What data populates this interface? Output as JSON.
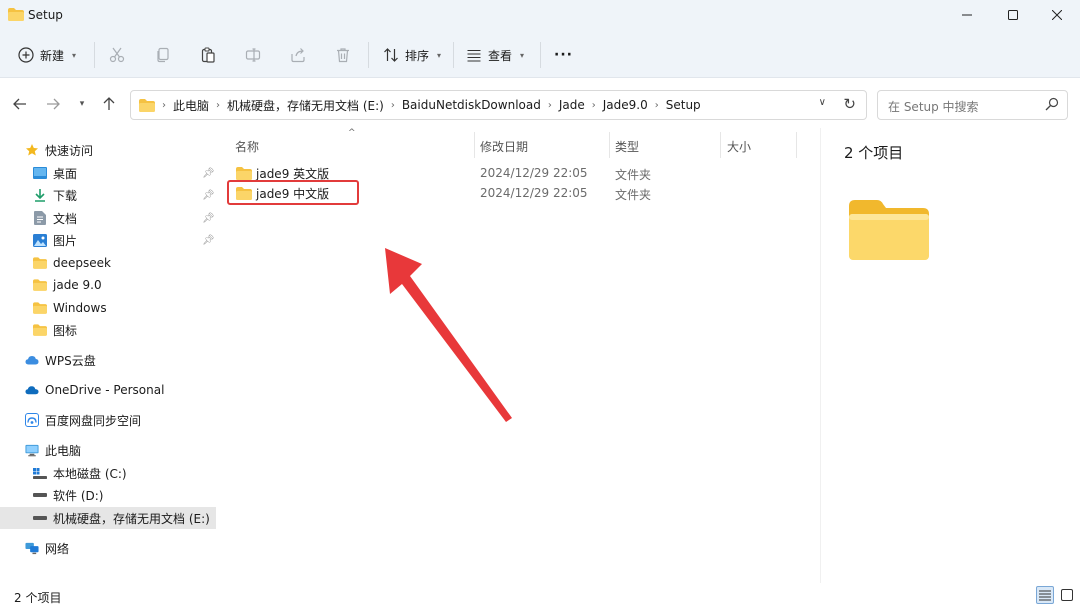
{
  "window": {
    "title": "Setup"
  },
  "toolbar": {
    "new_label": "新建",
    "sort_label": "排序",
    "view_label": "查看",
    "more_label": "···"
  },
  "address": {
    "crumbs": [
      "此电脑",
      "机械硬盘，存储无用文档 (E:)",
      "BaiduNetdiskDownload",
      "Jade",
      "Jade9.0",
      "Setup"
    ]
  },
  "search": {
    "placeholder": "在 Setup 中搜索"
  },
  "sidebar": {
    "quick_access": "快速访问",
    "items": [
      {
        "label": "桌面",
        "icon": "desktop-icon"
      },
      {
        "label": "下载",
        "icon": "download-icon"
      },
      {
        "label": "文档",
        "icon": "document-icon"
      },
      {
        "label": "图片",
        "icon": "picture-icon"
      },
      {
        "label": "deepseek",
        "icon": "folder-icon"
      },
      {
        "label": "jade 9.0",
        "icon": "folder-icon"
      },
      {
        "label": "Windows",
        "icon": "folder-icon"
      },
      {
        "label": "图标",
        "icon": "folder-icon"
      }
    ],
    "wps": "WPS云盘",
    "onedrive": "OneDrive - Personal",
    "baidu": "百度网盘同步空间",
    "this_pc": "此电脑",
    "drives": [
      {
        "label": "本地磁盘 (C:)"
      },
      {
        "label": "软件 (D:)"
      },
      {
        "label": "机械硬盘，存储无用文档 (E:)"
      }
    ],
    "network": "网络"
  },
  "list": {
    "columns": {
      "name": "名称",
      "date": "修改日期",
      "type": "类型",
      "size": "大小"
    },
    "rows": [
      {
        "name": "jade9 英文版",
        "date": "2024/12/29 22:05",
        "type": "文件夹"
      },
      {
        "name": "jade9 中文版",
        "date": "2024/12/29 22:05",
        "type": "文件夹"
      }
    ]
  },
  "details": {
    "count": "2 个项目"
  },
  "status": {
    "count": "2 个项目"
  },
  "colors": {
    "accent": "#0067c0",
    "folder": "#f5c242",
    "highlight": "#e23b3b",
    "chrome": "#eff4f9"
  }
}
